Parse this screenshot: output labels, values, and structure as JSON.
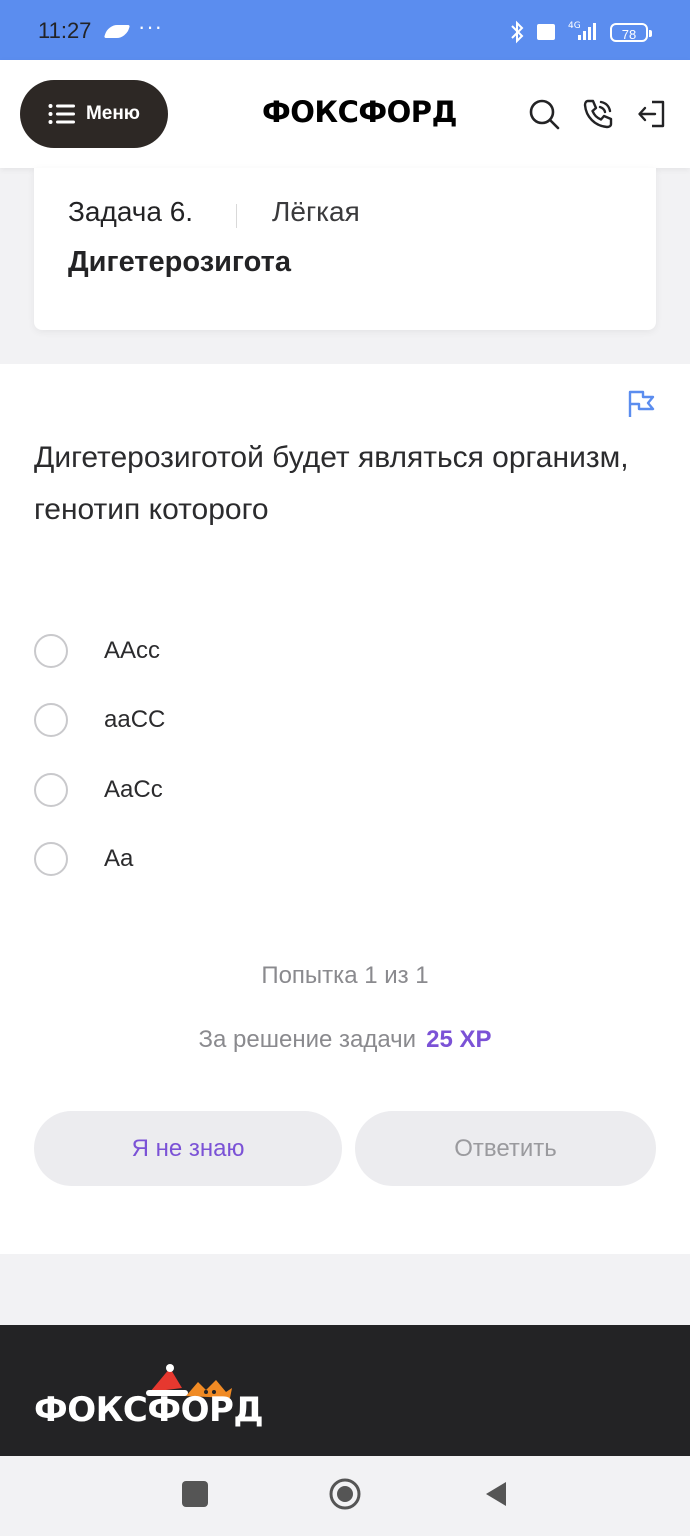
{
  "status_bar": {
    "time": "11:27",
    "dots": "···",
    "network": "4G",
    "battery": "78"
  },
  "header": {
    "menu_label": "Меню",
    "logo": "ФОКСФОРД"
  },
  "task": {
    "number": "Задача 6.",
    "difficulty": "Лёгкая",
    "title": "Дигетерозигота"
  },
  "question": {
    "text": "Дигетерозиготой будет являться организм, генотип которого",
    "options": [
      "AAcc",
      "aaCC",
      "AaCc",
      "Aa"
    ]
  },
  "attempts": "Попытка 1 из 1",
  "reward": {
    "label": "За решение задачи",
    "xp": "25 XP"
  },
  "buttons": {
    "dont_know": "Я не знаю",
    "answer": "Ответить"
  },
  "footer": {
    "logo": "ФОКСФОРД"
  },
  "colors": {
    "status_bar": "#5b8def",
    "accent": "#7b52d6",
    "menu_button": "#2d2825",
    "footer": "#232325"
  }
}
